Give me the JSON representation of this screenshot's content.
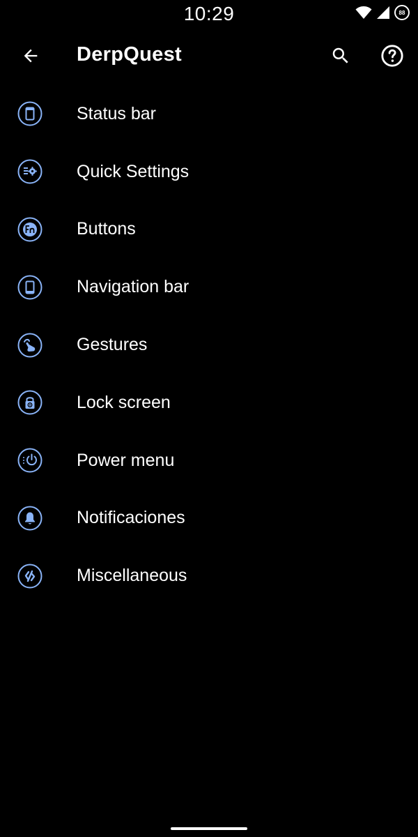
{
  "status_bar": {
    "time": "10:29",
    "battery_level": "88",
    "wifi_icon": "wifi-icon",
    "signal_icon": "cell-signal-icon"
  },
  "app_bar": {
    "title": "DerpQuest",
    "back_icon": "arrow-back-icon",
    "search_icon": "search-icon",
    "help_icon": "help-icon"
  },
  "menu": {
    "items": [
      {
        "label": "Status bar",
        "icon": "status-bar-icon"
      },
      {
        "label": "Quick Settings",
        "icon": "quick-settings-icon"
      },
      {
        "label": "Buttons",
        "icon": "fn-buttons-icon"
      },
      {
        "label": "Navigation bar",
        "icon": "phone-icon"
      },
      {
        "label": "Gestures",
        "icon": "gesture-icon"
      },
      {
        "label": "Lock screen",
        "icon": "lock-icon"
      },
      {
        "label": "Power menu",
        "icon": "power-icon"
      },
      {
        "label": "Notificaciones",
        "icon": "bell-icon"
      },
      {
        "label": "Miscellaneous",
        "icon": "misc-icon"
      }
    ]
  },
  "colors": {
    "background": "#000000",
    "text": "#ffffff",
    "accent": "#8ab4f8"
  }
}
